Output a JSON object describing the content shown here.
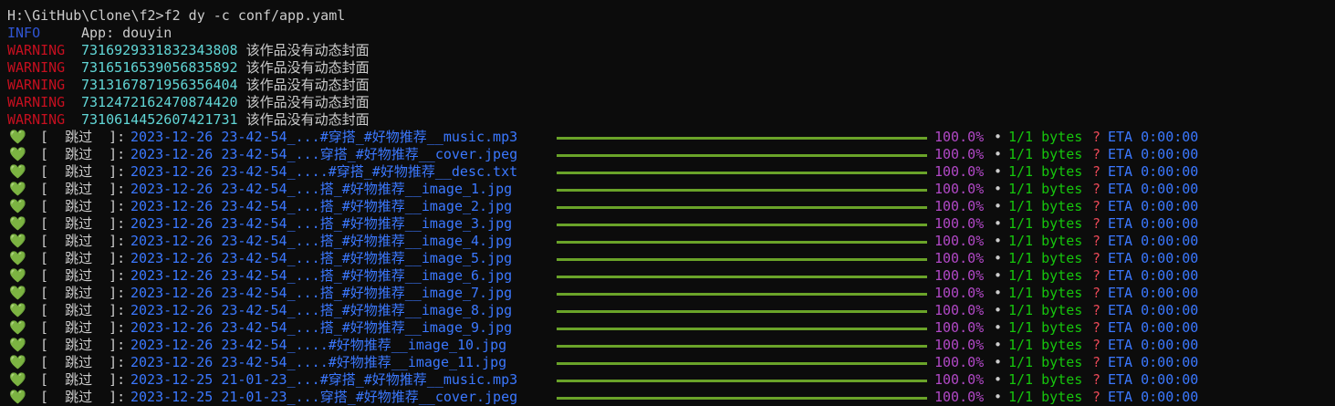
{
  "prompt": "H:\\GitHub\\Clone\\f2>",
  "command": "f2 dy -c conf/app.yaml",
  "info": {
    "level": "INFO",
    "message": "App: douyin"
  },
  "warnings": [
    {
      "level": "WARNING",
      "id": "7316929331832343808",
      "message": "该作品没有动态封面"
    },
    {
      "level": "WARNING",
      "id": "7316516539056835892",
      "message": "该作品没有动态封面"
    },
    {
      "level": "WARNING",
      "id": "7313167871956356404",
      "message": "该作品没有动态封面"
    },
    {
      "level": "WARNING",
      "id": "7312472162470874420",
      "message": "该作品没有动态封面"
    },
    {
      "level": "WARNING",
      "id": "7310614452607421731",
      "message": "该作品没有动态封面"
    }
  ],
  "downloads": [
    {
      "icon": "💚",
      "status": "[  跳过  ]:",
      "file": "2023-12-26 23-42-54_...#穿搭_#好物推荐__music.mp3",
      "progress": 1.0,
      "percent": "100.0%",
      "sep": "•",
      "bytes": "1/1 bytes",
      "rate": "?",
      "eta": "ETA 0:00:00"
    },
    {
      "icon": "💚",
      "status": "[  跳过  ]:",
      "file": "2023-12-26 23-42-54_...穿搭_#好物推荐__cover.jpeg",
      "progress": 1.0,
      "percent": "100.0%",
      "sep": "•",
      "bytes": "1/1 bytes",
      "rate": "?",
      "eta": "ETA 0:00:00"
    },
    {
      "icon": "💚",
      "status": "[  跳过  ]:",
      "file": "2023-12-26 23-42-54_....#穿搭_#好物推荐__desc.txt",
      "progress": 1.0,
      "percent": "100.0%",
      "sep": "•",
      "bytes": "1/1 bytes",
      "rate": "?",
      "eta": "ETA 0:00:00"
    },
    {
      "icon": "💚",
      "status": "[  跳过  ]:",
      "file": "2023-12-26 23-42-54_...搭_#好物推荐__image_1.jpg",
      "progress": 1.0,
      "percent": "100.0%",
      "sep": "•",
      "bytes": "1/1 bytes",
      "rate": "?",
      "eta": "ETA 0:00:00"
    },
    {
      "icon": "💚",
      "status": "[  跳过  ]:",
      "file": "2023-12-26 23-42-54_...搭_#好物推荐__image_2.jpg",
      "progress": 1.0,
      "percent": "100.0%",
      "sep": "•",
      "bytes": "1/1 bytes",
      "rate": "?",
      "eta": "ETA 0:00:00"
    },
    {
      "icon": "💚",
      "status": "[  跳过  ]:",
      "file": "2023-12-26 23-42-54_...搭_#好物推荐__image_3.jpg",
      "progress": 1.0,
      "percent": "100.0%",
      "sep": "•",
      "bytes": "1/1 bytes",
      "rate": "?",
      "eta": "ETA 0:00:00"
    },
    {
      "icon": "💚",
      "status": "[  跳过  ]:",
      "file": "2023-12-26 23-42-54_...搭_#好物推荐__image_4.jpg",
      "progress": 1.0,
      "percent": "100.0%",
      "sep": "•",
      "bytes": "1/1 bytes",
      "rate": "?",
      "eta": "ETA 0:00:00"
    },
    {
      "icon": "💚",
      "status": "[  跳过  ]:",
      "file": "2023-12-26 23-42-54_...搭_#好物推荐__image_5.jpg",
      "progress": 1.0,
      "percent": "100.0%",
      "sep": "•",
      "bytes": "1/1 bytes",
      "rate": "?",
      "eta": "ETA 0:00:00"
    },
    {
      "icon": "💚",
      "status": "[  跳过  ]:",
      "file": "2023-12-26 23-42-54_...搭_#好物推荐__image_6.jpg",
      "progress": 1.0,
      "percent": "100.0%",
      "sep": "•",
      "bytes": "1/1 bytes",
      "rate": "?",
      "eta": "ETA 0:00:00"
    },
    {
      "icon": "💚",
      "status": "[  跳过  ]:",
      "file": "2023-12-26 23-42-54_...搭_#好物推荐__image_7.jpg",
      "progress": 1.0,
      "percent": "100.0%",
      "sep": "•",
      "bytes": "1/1 bytes",
      "rate": "?",
      "eta": "ETA 0:00:00"
    },
    {
      "icon": "💚",
      "status": "[  跳过  ]:",
      "file": "2023-12-26 23-42-54_...搭_#好物推荐__image_8.jpg",
      "progress": 1.0,
      "percent": "100.0%",
      "sep": "•",
      "bytes": "1/1 bytes",
      "rate": "?",
      "eta": "ETA 0:00:00"
    },
    {
      "icon": "💚",
      "status": "[  跳过  ]:",
      "file": "2023-12-26 23-42-54_...搭_#好物推荐__image_9.jpg",
      "progress": 1.0,
      "percent": "100.0%",
      "sep": "•",
      "bytes": "1/1 bytes",
      "rate": "?",
      "eta": "ETA 0:00:00"
    },
    {
      "icon": "💚",
      "status": "[  跳过  ]:",
      "file": "2023-12-26 23-42-54_....#好物推荐__image_10.jpg",
      "progress": 1.0,
      "percent": "100.0%",
      "sep": "•",
      "bytes": "1/1 bytes",
      "rate": "?",
      "eta": "ETA 0:00:00"
    },
    {
      "icon": "💚",
      "status": "[  跳过  ]:",
      "file": "2023-12-26 23-42-54_....#好物推荐__image_11.jpg",
      "progress": 1.0,
      "percent": "100.0%",
      "sep": "•",
      "bytes": "1/1 bytes",
      "rate": "?",
      "eta": "ETA 0:00:00"
    },
    {
      "icon": "💚",
      "status": "[  跳过  ]:",
      "file": "2023-12-25 21-01-23_...#穿搭_#好物推荐__music.mp3",
      "progress": 1.0,
      "percent": "100.0%",
      "sep": "•",
      "bytes": "1/1 bytes",
      "rate": "?",
      "eta": "ETA 0:00:00"
    },
    {
      "icon": "💚",
      "status": "[  跳过  ]:",
      "file": "2023-12-25 21-01-23_...穿搭_#好物推荐__cover.jpeg",
      "progress": 1.0,
      "percent": "100.0%",
      "sep": "•",
      "bytes": "1/1 bytes",
      "rate": "?",
      "eta": "ETA 0:00:00"
    }
  ]
}
